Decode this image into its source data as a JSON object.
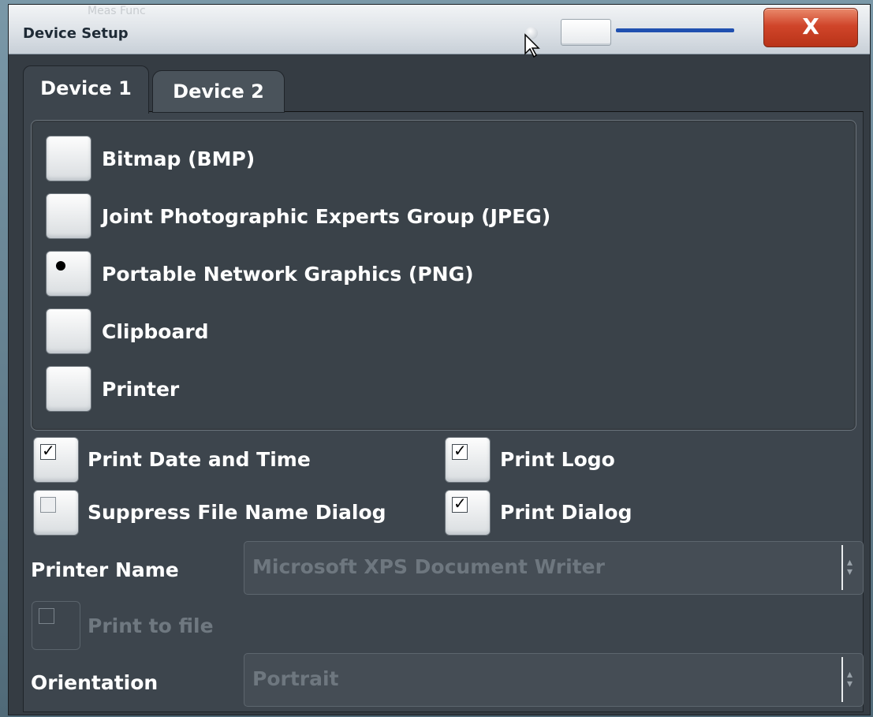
{
  "window": {
    "title": "Device Setup",
    "background_title": "Meas Func",
    "close_label": "X"
  },
  "tabs": [
    {
      "label": "Device 1",
      "active": true
    },
    {
      "label": "Device 2",
      "active": false
    }
  ],
  "output_options": [
    {
      "label": "Bitmap (BMP)",
      "selected": false
    },
    {
      "label": "Joint Photographic Experts Group (JPEG)",
      "selected": false
    },
    {
      "label": "Portable Network Graphics (PNG)",
      "selected": true
    },
    {
      "label": "Clipboard",
      "selected": false
    },
    {
      "label": "Printer",
      "selected": false
    }
  ],
  "checkboxes": {
    "print_date_time": {
      "label": "Print Date and Time",
      "checked": true
    },
    "print_logo": {
      "label": "Print Logo",
      "checked": true
    },
    "suppress_dialog": {
      "label": "Suppress File Name Dialog",
      "checked": false
    },
    "print_dialog": {
      "label": "Print Dialog",
      "checked": true
    },
    "print_to_file": {
      "label": "Print to file",
      "checked": false,
      "enabled": false
    }
  },
  "printer": {
    "label": "Printer Name",
    "value": "Microsoft XPS Document Writer"
  },
  "orientation": {
    "label": "Orientation",
    "value": "Portrait"
  },
  "colors": {
    "dialog_bg": "#3d454d",
    "close_button": "#d0452a",
    "slider_track": "#2050b0"
  }
}
